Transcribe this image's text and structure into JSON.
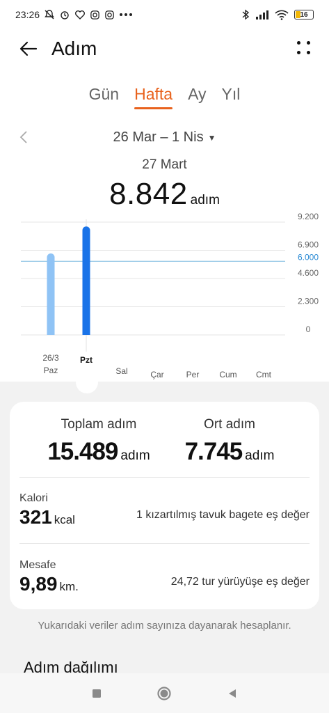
{
  "status": {
    "time": "23:26",
    "battery": "16"
  },
  "appbar": {
    "title": "Adım"
  },
  "tabs": [
    {
      "label": "Gün"
    },
    {
      "label": "Hafta"
    },
    {
      "label": "Ay"
    },
    {
      "label": "Yıl"
    }
  ],
  "range": {
    "label": "26 Mar – 1 Nis"
  },
  "selected": {
    "date": "27 Mart",
    "value": "8.842",
    "unit": "adım"
  },
  "chart_data": {
    "type": "bar",
    "categories": [
      "Paz",
      "Pzt",
      "Sal",
      "Çar",
      "Per",
      "Cum",
      "Cmt"
    ],
    "category_dates": [
      "26/3",
      "",
      "",
      "",
      "",
      "",
      ""
    ],
    "values": [
      6647,
      8842,
      0,
      0,
      0,
      0,
      0
    ],
    "yticks": [
      "9.200",
      "6.900",
      "4.600",
      "2.300",
      "0"
    ],
    "ytick_values": [
      9200,
      6900,
      4600,
      2300,
      0
    ],
    "ylim": [
      0,
      9200
    ],
    "goal": 6000,
    "goal_label": "6.000",
    "selected_index": 1,
    "colors": {
      "bar": "#8fc3f5",
      "bar_selected": "#1a73e8",
      "goal": "#9ccbe8",
      "goal_label": "#2a8ad4",
      "grid": "#e6e6e6"
    }
  },
  "summary": {
    "total_label": "Toplam adım",
    "total_value": "15.489",
    "total_unit": "adım",
    "avg_label": "Ort adım",
    "avg_value": "7.745",
    "avg_unit": "adım",
    "calorie_label": "Kalori",
    "calorie_value": "321",
    "calorie_unit": "kcal",
    "calorie_eq": "1 kızartılmış tavuk bagete eş değer",
    "distance_label": "Mesafe",
    "distance_value": "9,89",
    "distance_unit": "km.",
    "distance_eq": "24,72 tur yürüyüşe eş değer"
  },
  "note": "Yukarıdaki veriler adım sayınıza dayanarak hesaplanır.",
  "section_title": "Adım dağılımı"
}
